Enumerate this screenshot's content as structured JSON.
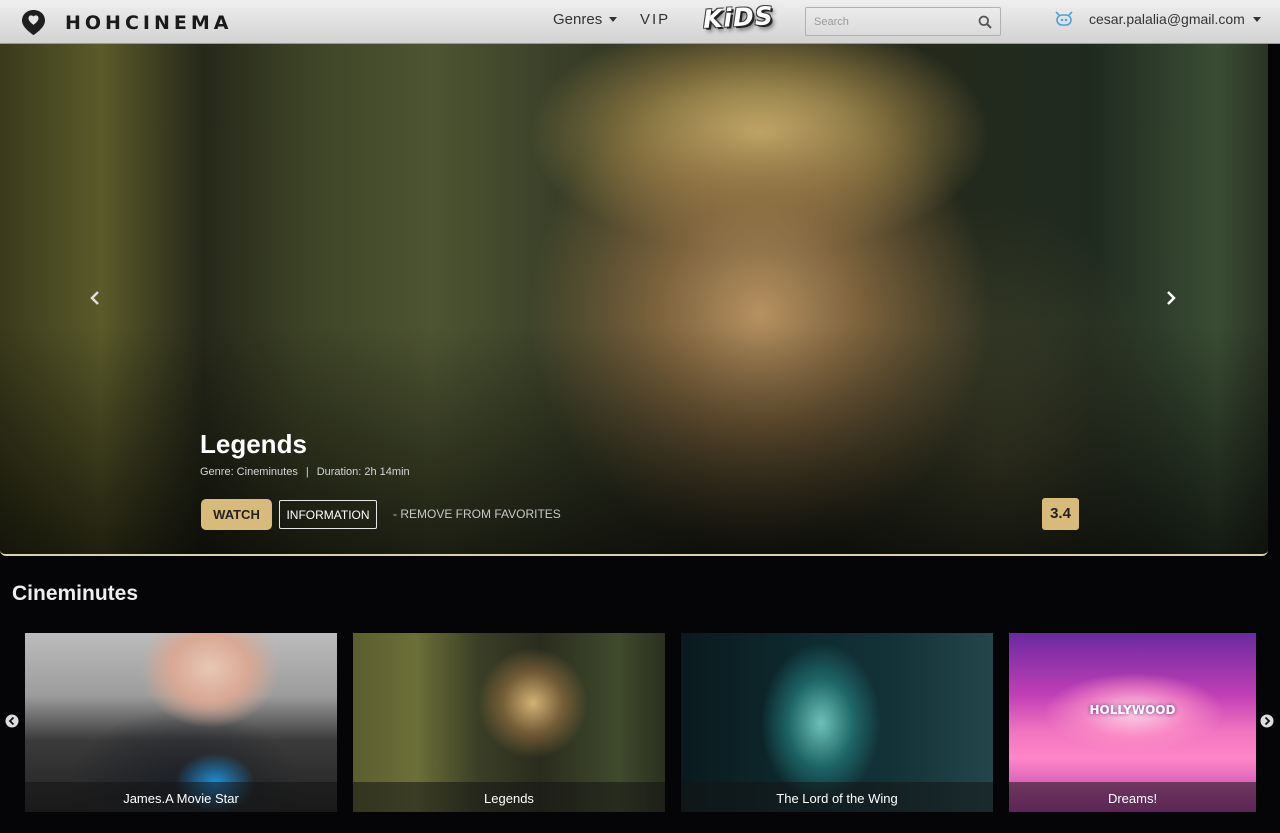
{
  "header": {
    "brand": "HOHCINEMA",
    "genres_label": "Genres",
    "vip_label": "VIP",
    "kids_label": "KiDS",
    "search_placeholder": "Search",
    "user_email": "cesar.palalia@gmail.com"
  },
  "hero": {
    "title": "Legends",
    "genre": "Genre: Cineminutes",
    "separator": "|",
    "duration": "Duration: 2h 14min",
    "watch_label": "WATCH",
    "info_label": "INFORMATION",
    "remove_favorites_label": "- REMOVE FROM FAVORITES",
    "rating": "3.4"
  },
  "row": {
    "title": "Cineminutes",
    "items": [
      {
        "caption": "James.A Movie Star"
      },
      {
        "caption": "Legends"
      },
      {
        "caption": "The Lord of the Wing"
      },
      {
        "caption": "Dreams!",
        "poster_text": "HOLLYWOOD"
      }
    ]
  },
  "colors": {
    "accent": "#d8ba7a",
    "background": "#050507",
    "topbar": "#e0e0e0"
  },
  "icons": {
    "logo": "map-pin-heart-icon",
    "search": "search-icon",
    "avatar": "user-avatar-icon",
    "prev": "chevron-left-icon",
    "next": "chevron-right-icon"
  }
}
